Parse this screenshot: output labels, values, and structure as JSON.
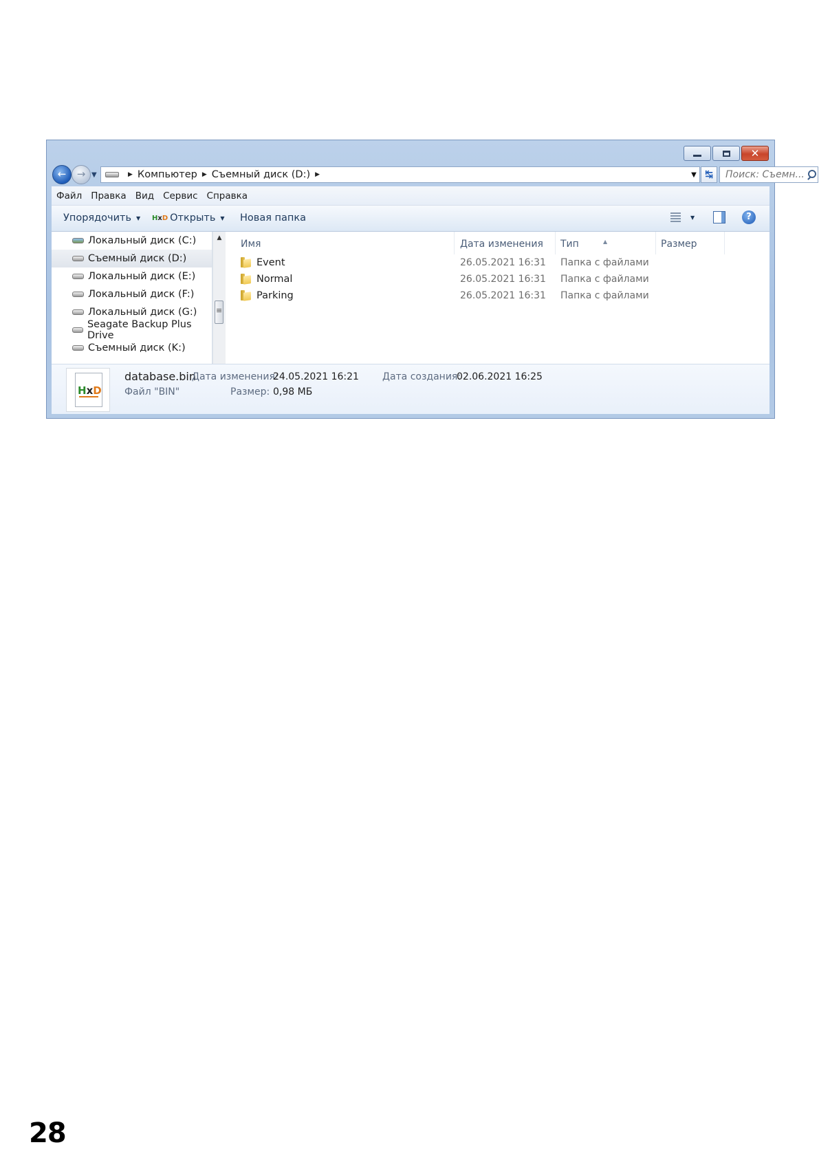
{
  "nav_bar": {
    "path": [
      "Компьютер",
      "Съемный диск (D:)"
    ],
    "search_placeholder": "Поиск: Съемн..."
  },
  "menu": [
    "Файл",
    "Правка",
    "Вид",
    "Сервис",
    "Справка"
  ],
  "toolbar": {
    "organize": "Упорядочить",
    "open": "Открыть",
    "new_folder": "Новая папка"
  },
  "sidebar": {
    "items": [
      {
        "label": "Локальный диск (C:)",
        "icon": "system-drive-icon"
      },
      {
        "label": "Съемный диск (D:)",
        "icon": "removable-drive-icon",
        "selected": true
      },
      {
        "label": "Локальный диск (E:)",
        "icon": "drive-icon"
      },
      {
        "label": "Локальный диск (F:)",
        "icon": "drive-icon"
      },
      {
        "label": "Локальный диск (G:)",
        "icon": "drive-icon"
      },
      {
        "label": "Seagate Backup Plus Drive",
        "icon": "drive-icon"
      },
      {
        "label": "Съемный диск (K:)",
        "icon": "removable-drive-icon"
      }
    ]
  },
  "file_list": {
    "columns": [
      "Имя",
      "Дата изменения",
      "Тип",
      "Размер"
    ],
    "rows": [
      {
        "name": "Event",
        "date": "26.05.2021 16:31",
        "type": "Папка с файлами"
      },
      {
        "name": "Normal",
        "date": "26.05.2021 16:31",
        "type": "Папка с файлами"
      },
      {
        "name": "Parking",
        "date": "26.05.2021 16:31",
        "type": "Папка с файлами"
      }
    ]
  },
  "details": {
    "filename": "database.bin",
    "filetype": "Файл \"BIN\"",
    "modified_label": "Дата изменения:",
    "modified_value": "24.05.2021 16:21",
    "size_label": "Размер:",
    "size_value": "0,98 МБ",
    "created_label": "Дата создания:",
    "created_value": "02.06.2021 16:25",
    "icon_logo": "HxD"
  },
  "page_number": "28"
}
